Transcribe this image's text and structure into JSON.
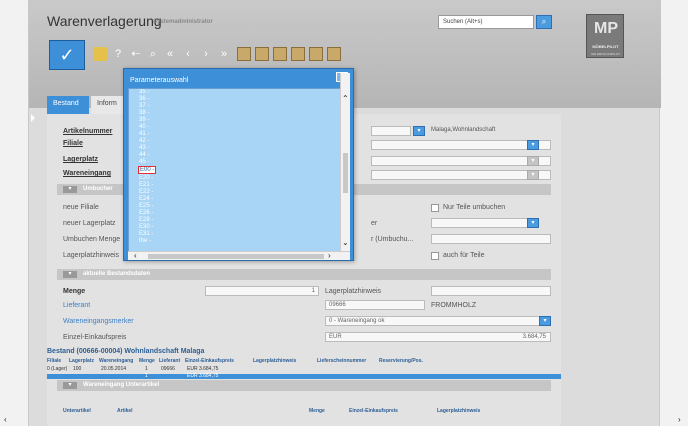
{
  "header": {
    "title": "Warenverlagerung",
    "subtitle": "Systemadministrator",
    "search_placeholder": "Suchen (Alt+s)"
  },
  "logo": {
    "text": "MP",
    "brand": "MÖBELPILOT",
    "slogan": "IHR ERFOLGSPILOT"
  },
  "toolbar": {
    "confirm_icon": "checkmark-icon",
    "items": [
      "folder-icon",
      "help-icon",
      "back-icon",
      "search-icon",
      "first-icon",
      "prev-icon",
      "next-icon",
      "last-icon"
    ]
  },
  "tabs": [
    "Bestand",
    "Inform"
  ],
  "form": {
    "artikelnummer_label": "Artikelnummer",
    "filiale_label": "Filiale",
    "lagerplatz_label": "Lagerplatz",
    "wareneingang_label": "Wareneingang",
    "artikel_desc": "Malaga,Wohnlandschaft",
    "umbuchen_section": "Umbucher",
    "neue_filiale_label": "neue Filiale",
    "neuer_lagerplatz_label": "neuer Lagerplatz",
    "umbuchen_menge_label": "Umbuchen Menge",
    "lagerplatzhinweis_label": "Lagerplatzhinweis",
    "nur_teile_label": "Nur Teile umbuchen",
    "er_label": "er",
    "umbuchung_label": "r (Umbuchu...",
    "auch_teile_label": "auch für Teile",
    "bestandsdaten_section": "aktuelle Bestandsdaten",
    "menge_label": "Menge",
    "menge_value": "1",
    "lagerplatzhinweis2_label": "Lagerplatzhinweis",
    "lieferant_label": "Lieferant",
    "lieferant_nr": "09666",
    "lieferant_name": "FROMMHOLZ",
    "wareneingangsmerker_label": "Wareneingangsmerker",
    "wareneingangsmerker_value": "0 - Wareneingang ok",
    "einzel_ek_label": "Einzel-Einkaufspreis",
    "currency": "EUR",
    "einzel_ek_value": "3.684,75"
  },
  "bestand_table": {
    "title": "Bestand (00666-00004) Wohnlandschaft Malaga",
    "headers": [
      "Filiale",
      "Lagerplatz",
      "Wareneingang",
      "Menge",
      "Lieferant",
      "Einzel-Einkaufspreis",
      "Lagerplatzhinweis",
      "Lieferscheinnummer",
      "Reservierung/Pos."
    ],
    "row": [
      "0 (Lager)",
      "100",
      "20.05.2014",
      "1",
      "09666",
      "EUR 3.684,75"
    ],
    "sum": [
      "1",
      "EUR 3.684,75"
    ]
  },
  "unterartikel_section": "Wareneingang Unterartikel",
  "unterartikel_headers": [
    "Unterartikel",
    "Artikel",
    "Menge",
    "Einzel-Einkaufspreis",
    "Lagerplatzhinweis"
  ],
  "modal": {
    "title": "Parameterauswahl",
    "items": [
      "35 -",
      "36 -",
      "37 -",
      "38 -",
      "39 -",
      "40 -",
      "41 -",
      "42 -",
      "43 -",
      "44 -",
      "45 -",
      "E00 -",
      "E20 -",
      "E21 -",
      "E22 -",
      "E24 -",
      "E25 -",
      "E26 -",
      "E28 -",
      "E30 -",
      "E31 -",
      "the -"
    ],
    "selected_index": 11
  }
}
